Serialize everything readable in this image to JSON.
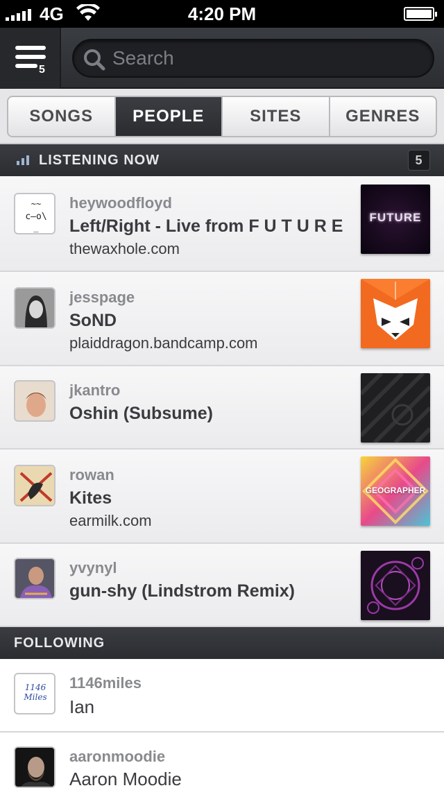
{
  "status_bar": {
    "carrier": "4G",
    "time": "4:20 PM"
  },
  "header": {
    "menu_count": "5",
    "search_placeholder": "Search"
  },
  "tabs": [
    {
      "label": "SONGS",
      "active": false
    },
    {
      "label": "PEOPLE",
      "active": true
    },
    {
      "label": "SITES",
      "active": false
    },
    {
      "label": "GENRES",
      "active": false
    }
  ],
  "listening_now": {
    "title": "LISTENING NOW",
    "count": "5",
    "items": [
      {
        "username": "heywoodfloyd",
        "track": "Left/Right - Live from F U T U R E",
        "site": "thewaxhole.com",
        "art_text": "FUTURE"
      },
      {
        "username": "jesspage",
        "track": "SoND",
        "site": "plaiddragon.bandcamp.com",
        "art_text": ""
      },
      {
        "username": "jkantro",
        "track": "Oshin (Subsume)",
        "site": "",
        "art_text": ""
      },
      {
        "username": "rowan",
        "track": "Kites",
        "site": "earmilk.com",
        "art_text": "GEOGRAPHER"
      },
      {
        "username": "yvynyl",
        "track": "gun-shy (Lindstrom Remix)",
        "site": "",
        "art_text": ""
      }
    ]
  },
  "following": {
    "title": "FOLLOWING",
    "items": [
      {
        "username": "1146miles",
        "name": "Ian",
        "avatar_text": "1146 Miles"
      },
      {
        "username": "aaronmoodie",
        "name": "Aaron Moodie"
      }
    ]
  },
  "colors": {
    "accent_dark": "#2b2d31",
    "text_muted": "#888a8e",
    "text_main": "#3a3b3e"
  }
}
